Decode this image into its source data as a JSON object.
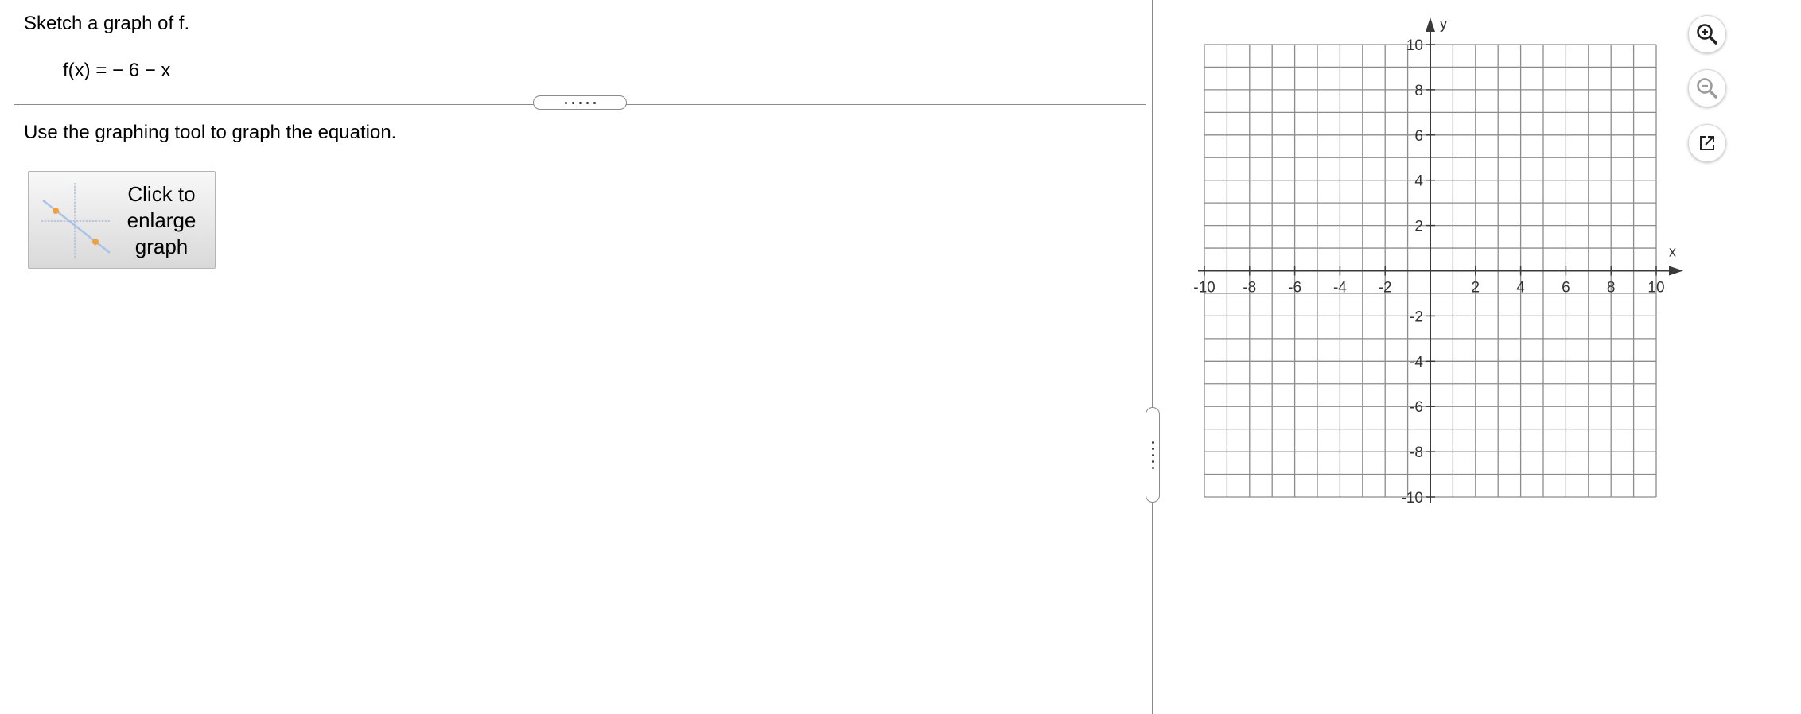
{
  "question": {
    "prompt": "Sketch a graph of f.",
    "function": "f(x) = − 6 − x",
    "instruction": "Use the graphing tool to graph the equation."
  },
  "enlarge_button": {
    "label": "Click to enlarge graph",
    "icon": "graph-thumbnail-icon"
  },
  "graph": {
    "x_axis_label": "x",
    "y_axis_label": "y",
    "x_range": [
      -10,
      10
    ],
    "y_range": [
      -10,
      10
    ],
    "grid_step": 1,
    "tick_step": 2,
    "x_tick_labels": [
      "-10",
      "-8",
      "-6",
      "-4",
      "-2",
      "2",
      "4",
      "6",
      "8",
      "10"
    ],
    "y_tick_labels": [
      "10",
      "8",
      "6",
      "4",
      "2",
      "-2",
      "-4",
      "-6",
      "-8",
      "-10"
    ],
    "grid": true,
    "plotted_points": []
  },
  "toolbar": {
    "zoom_in_icon": "zoom-in-icon",
    "zoom_out_icon": "zoom-out-icon",
    "popout_icon": "popout-icon"
  },
  "colors": {
    "grid": "#8c8c8c",
    "axis": "#3a3a3a",
    "toolbar_icon": "#222222",
    "toolbar_icon_disabled": "#9a9a9a",
    "thumb_line": "#a9c3e8",
    "thumb_point": "#f0a040"
  }
}
